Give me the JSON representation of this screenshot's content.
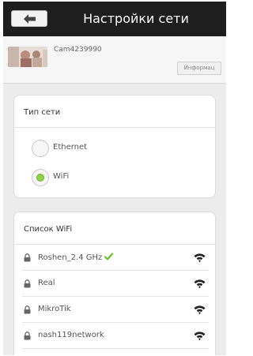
{
  "header": {
    "title": "Настройки сети",
    "back_icon": "arrow-left-icon"
  },
  "camera": {
    "name": "Cam4239990",
    "info_label": "Информац"
  },
  "network_type": {
    "title": "Тип сети",
    "options": [
      {
        "label": "Ethernet",
        "selected": false
      },
      {
        "label": "WiFi",
        "selected": true
      }
    ]
  },
  "wifi_list": {
    "title": "Список WiFi",
    "items": [
      {
        "name": "Roshen_2.4 GHz",
        "connected": true,
        "locked": true
      },
      {
        "name": "Real",
        "connected": false,
        "locked": true
      },
      {
        "name": "MikroTik",
        "connected": false,
        "locked": true
      },
      {
        "name": "nash119network",
        "connected": false,
        "locked": true
      }
    ]
  },
  "colors": {
    "header_bg": "#1e1e1e",
    "accent_green": "#8fd24a",
    "page_bg": "#ececec"
  }
}
